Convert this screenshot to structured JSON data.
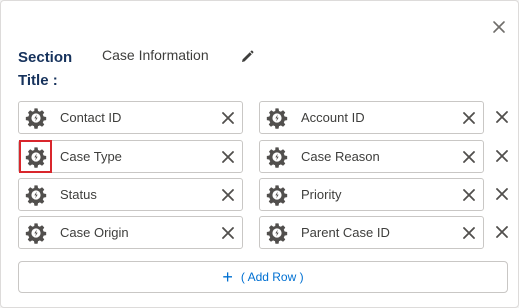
{
  "section": {
    "label": "Section Title :",
    "value": "Case Information"
  },
  "icons": {
    "close": "close-icon",
    "edit": "pencil-icon",
    "field": "gear-icon",
    "remove": "x-icon",
    "add": "plus-icon"
  },
  "colors": {
    "accent": "#0070d2",
    "highlight": "#d9262c",
    "title": "#16325c",
    "border": "#c9c7c5"
  },
  "rows": [
    {
      "left": "Contact ID",
      "right": "Account ID"
    },
    {
      "left": "Case Type",
      "right": "Case Reason"
    },
    {
      "left": "Status",
      "right": "Priority"
    },
    {
      "left": "Case Origin",
      "right": "Parent Case ID"
    }
  ],
  "highlighted_field": "Case Type",
  "add_row": {
    "plus": "+",
    "label": "( Add Row )"
  }
}
